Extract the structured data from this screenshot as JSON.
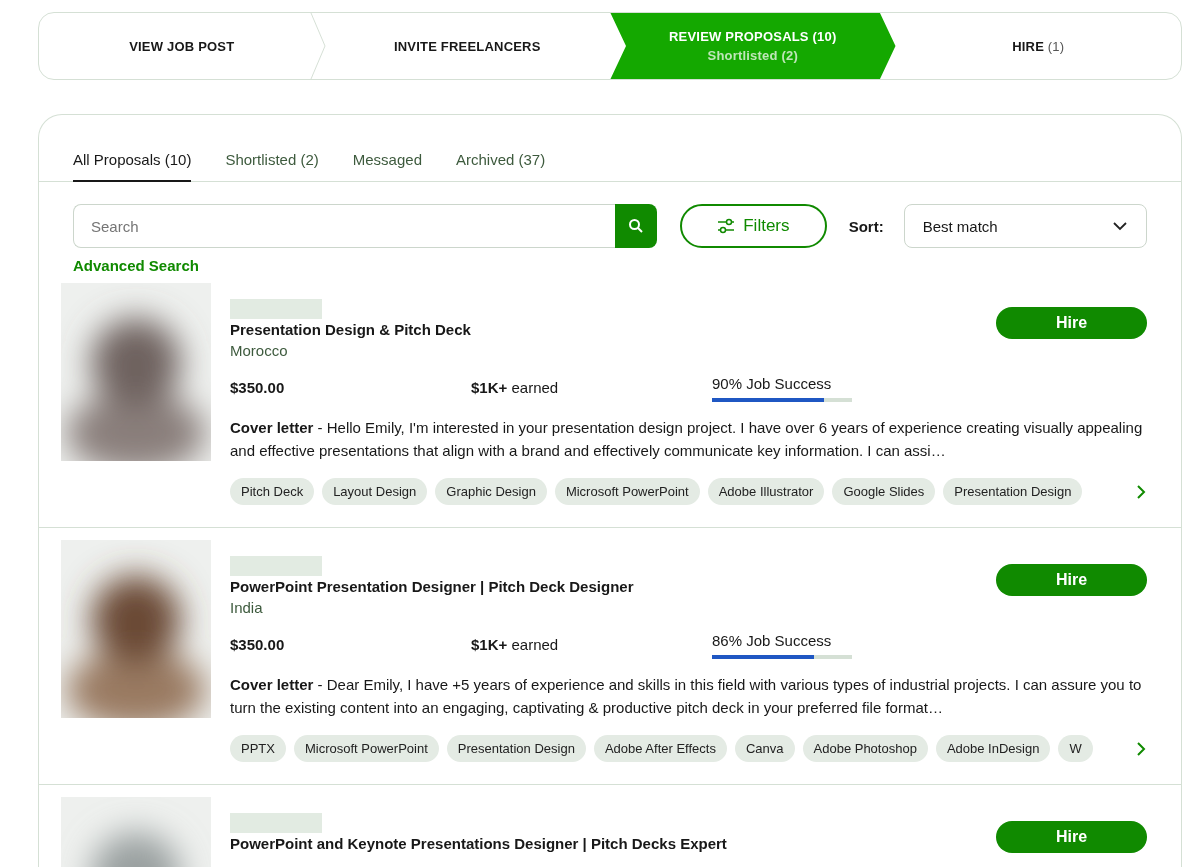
{
  "steps": [
    {
      "label": "VIEW JOB POST",
      "selected": false
    },
    {
      "label": "INVITE FREELANCERS",
      "selected": false
    },
    {
      "label": "REVIEW PROPOSALS (10)",
      "sub": "Shortlisted (2)",
      "selected": true
    },
    {
      "label": "HIRE",
      "count": "(1)",
      "selected": false
    }
  ],
  "tabs": [
    {
      "label": "All Proposals (10)",
      "selected": true
    },
    {
      "label": "Shortlisted (2)",
      "selected": false
    },
    {
      "label": "Messaged",
      "selected": false
    },
    {
      "label": "Archived (37)",
      "selected": false
    }
  ],
  "search": {
    "placeholder": "Search"
  },
  "filters_button": "Filters",
  "sort": {
    "label": "Sort:",
    "value": "Best match"
  },
  "advanced_search": "Advanced Search",
  "proposals": [
    {
      "title": "Presentation Design & Pitch Deck",
      "country": "Morocco",
      "rate": "$350.00",
      "earned": "**$1K+** earned",
      "job_success": "90% Job Success",
      "level": 0.8,
      "cover": "**Cover letter** - Hello Emily, I'm interested in your presentation design project. I have over 6 years of experience creating visually appealing and effective presentations that align with a brand and effectively communicate key information. I can assi…",
      "tags": [
        "Pitch Deck",
        "Layout Design",
        "Graphic Design",
        "Microsoft PowerPoint",
        "Adobe Illustrator",
        "Google Slides",
        "Presentation Design"
      ],
      "hire": "Hire"
    },
    {
      "title": "PowerPoint Presentation Designer | Pitch Deck Designer",
      "country": "India",
      "rate": "$350.00",
      "earned": "**$1K+** earned",
      "job_success": "86% Job Success",
      "level": 0.73,
      "cover": "**Cover letter** - Dear Emily, I have +5 years of experience and skills in this field with various types of industrial projects. I can assure you to turn the existing content into an engaging, captivating & productive pitch deck in your preferred file format…",
      "tags": [
        "PPTX",
        "Microsoft PowerPoint",
        "Presentation Design",
        "Adobe After Effects",
        "Canva",
        "Adobe Photoshop",
        "Adobe InDesign",
        "W"
      ],
      "hire": "Hire"
    },
    {
      "title": "PowerPoint and Keynote Presentations Designer | Pitch Decks Expert",
      "hire": "Hire"
    }
  ]
}
